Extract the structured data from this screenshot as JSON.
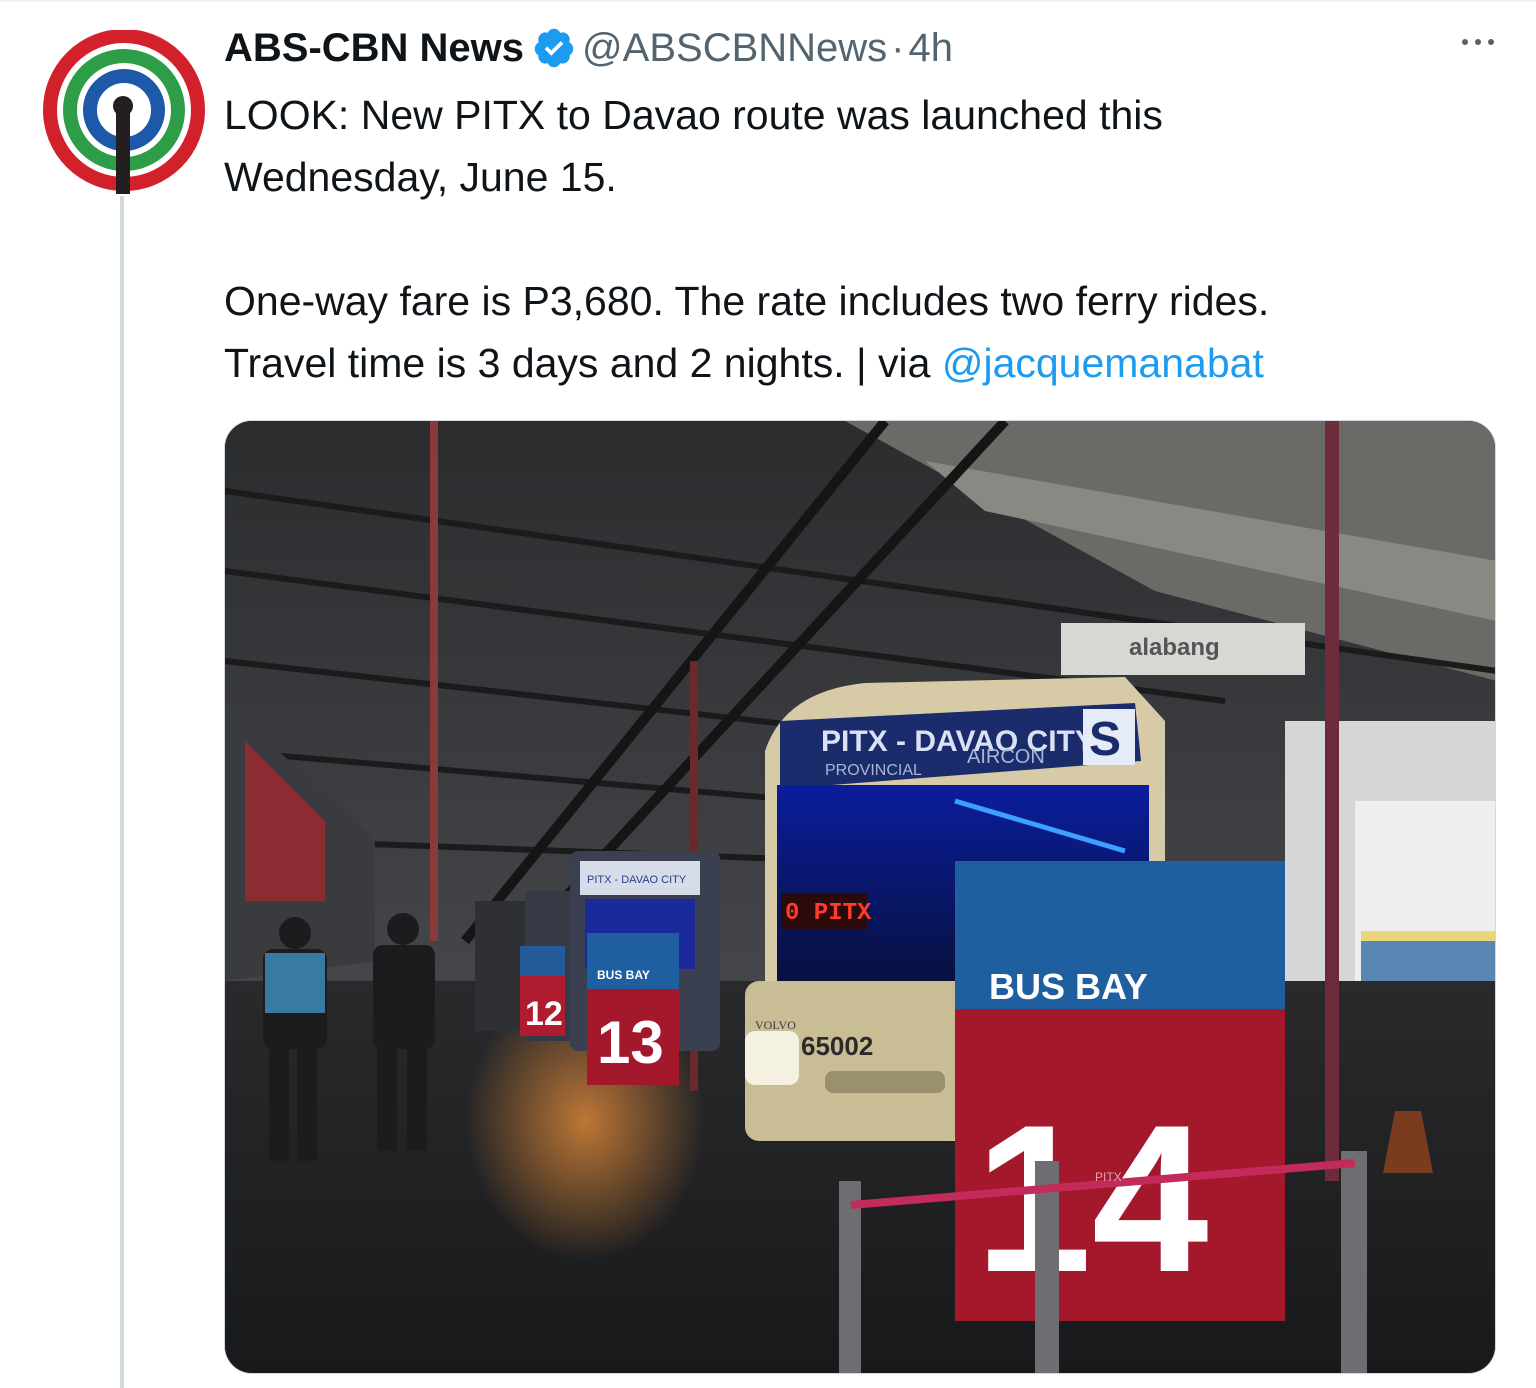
{
  "tweet": {
    "display_name": "ABS-CBN News",
    "handle": "@ABSCBNNews",
    "separator": "·",
    "time": "4h",
    "verified": true,
    "text_line1": "LOOK: New PITX to Davao route was launched this",
    "text_line2": "Wednesday, June 15.",
    "text_line3": "One-way fare is P3,680. The rate includes two ferry rides.",
    "text_line4_prefix": "Travel time is 3 days and 2 nights. | via ",
    "mention": "@jacquemanabat"
  },
  "photo": {
    "sign_top": "alabang",
    "bus_banner_main": "PITX - DAVAO CITY",
    "bus_banner_left": "PROVINCIAL",
    "bus_banner_right": "AIRCON",
    "bus_banner_letter": "S",
    "led_display": "0  PITX",
    "bus_brand": "VOLVO",
    "bus_number": "65002",
    "bay_label": "BUS BAY",
    "bay_number": "14",
    "bay13_label": "BUS BAY",
    "bay13_number": "13",
    "bay12_number": "12",
    "far_banner": "PITX - DAVAO CITY",
    "rope_text": "PITX"
  },
  "colors": {
    "accent": "#1d9bf0",
    "text_primary": "#0f1419",
    "text_secondary": "#536471",
    "abs_red": "#d3212c",
    "abs_green": "#2e9d47",
    "abs_blue": "#1e58a8",
    "bay_blue": "#1f5e9f",
    "bay_red": "#a3182b"
  },
  "icons": {
    "avatar": "abs-cbn-logo",
    "verified": "verified-badge-icon",
    "more": "more-options-icon"
  }
}
